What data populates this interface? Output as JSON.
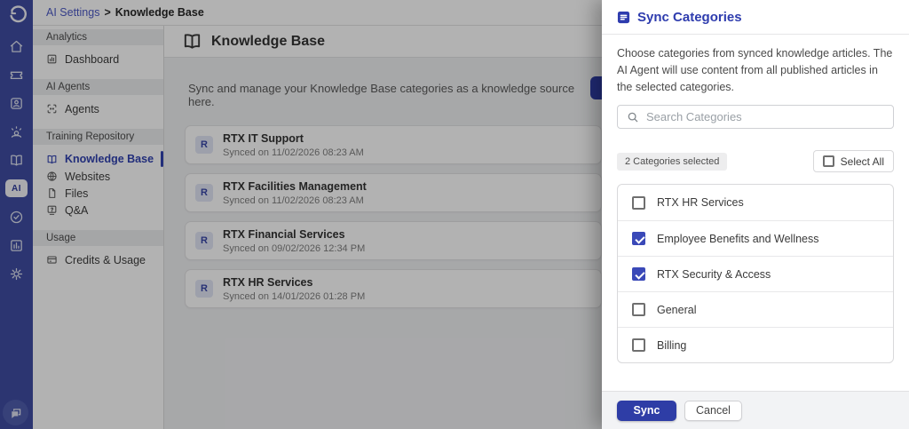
{
  "breadcrumb": {
    "link": "AI Settings",
    "separator": ">",
    "current": "Knowledge Base"
  },
  "rail": {
    "ai_label": "AI",
    "icons": [
      "app-logo",
      "home",
      "ticket",
      "contacts",
      "agent-assist",
      "knowledge-book",
      "ai-module",
      "tasks-check",
      "reports-chart",
      "settings-gear",
      "chat-launcher"
    ]
  },
  "sidebar": {
    "sections": [
      {
        "title": "Analytics",
        "items": [
          {
            "label": "Dashboard",
            "icon": "dashboard-icon",
            "active": false
          }
        ]
      },
      {
        "title": "AI Agents",
        "items": [
          {
            "label": "Agents",
            "icon": "bot-icon",
            "active": false
          }
        ]
      },
      {
        "title": "Training Repository",
        "items": [
          {
            "label": "Knowledge Base",
            "icon": "book-icon",
            "active": true
          },
          {
            "label": "Websites",
            "icon": "globe-icon",
            "active": false
          },
          {
            "label": "Files",
            "icon": "file-icon",
            "active": false
          },
          {
            "label": "Q&A",
            "icon": "qa-icon",
            "active": false
          }
        ]
      },
      {
        "title": "Usage",
        "items": [
          {
            "label": "Credits & Usage",
            "icon": "credits-icon",
            "active": false
          }
        ]
      }
    ]
  },
  "main": {
    "title": "Knowledge Base",
    "description": "Sync and manage your Knowledge Base categories as a knowledge source here.",
    "cards": [
      {
        "initial": "R",
        "title": "RTX IT Support",
        "synced": "Synced on 11/02/2026 08:23 AM"
      },
      {
        "initial": "R",
        "title": "RTX Facilities Management",
        "synced": "Synced on 11/02/2026 08:23 AM"
      },
      {
        "initial": "R",
        "title": "RTX Financial Services",
        "synced": "Synced on 09/02/2026 12:34 PM"
      },
      {
        "initial": "R",
        "title": "RTX HR Services",
        "synced": "Synced on 14/01/2026 01:28 PM"
      }
    ]
  },
  "modal": {
    "title": "Sync Categories",
    "description": "Choose categories from synced knowledge articles. The AI Agent will use content from all published articles in the selected categories.",
    "search_placeholder": "Search Categories",
    "selected_count_label": "2 Categories selected",
    "select_all_label": "Select All",
    "select_all_checked": false,
    "categories": [
      {
        "label": "RTX HR Services",
        "checked": false
      },
      {
        "label": "Employee Benefits and Wellness",
        "checked": true
      },
      {
        "label": "RTX Security & Access",
        "checked": true
      },
      {
        "label": "General",
        "checked": false
      },
      {
        "label": "Billing",
        "checked": false
      }
    ],
    "sync_label": "Sync",
    "cancel_label": "Cancel"
  },
  "colors": {
    "accent": "#2e3da6",
    "modal_title_blue": "#2e3cae",
    "rail_background": "#3f4ca3",
    "checkbox_checked": "#3a49b8",
    "active_nav_blue": "#3142b0"
  }
}
